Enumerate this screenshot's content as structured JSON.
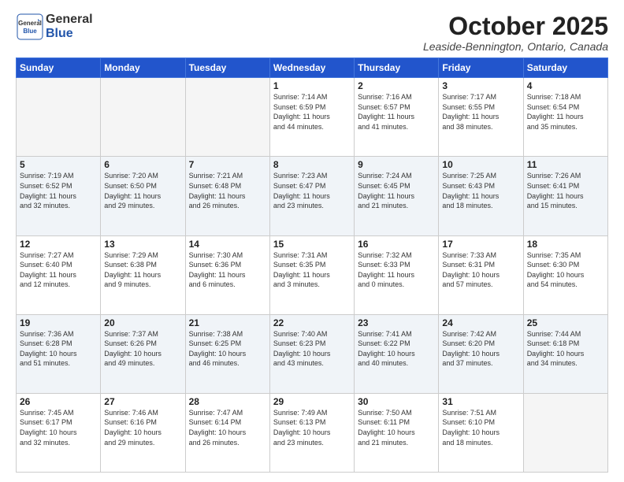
{
  "header": {
    "logo_line1": "General",
    "logo_line2": "Blue",
    "month": "October 2025",
    "location": "Leaside-Bennington, Ontario, Canada"
  },
  "weekdays": [
    "Sunday",
    "Monday",
    "Tuesday",
    "Wednesday",
    "Thursday",
    "Friday",
    "Saturday"
  ],
  "weeks": [
    [
      {
        "day": "",
        "info": ""
      },
      {
        "day": "",
        "info": ""
      },
      {
        "day": "",
        "info": ""
      },
      {
        "day": "1",
        "info": "Sunrise: 7:14 AM\nSunset: 6:59 PM\nDaylight: 11 hours\nand 44 minutes."
      },
      {
        "day": "2",
        "info": "Sunrise: 7:16 AM\nSunset: 6:57 PM\nDaylight: 11 hours\nand 41 minutes."
      },
      {
        "day": "3",
        "info": "Sunrise: 7:17 AM\nSunset: 6:55 PM\nDaylight: 11 hours\nand 38 minutes."
      },
      {
        "day": "4",
        "info": "Sunrise: 7:18 AM\nSunset: 6:54 PM\nDaylight: 11 hours\nand 35 minutes."
      }
    ],
    [
      {
        "day": "5",
        "info": "Sunrise: 7:19 AM\nSunset: 6:52 PM\nDaylight: 11 hours\nand 32 minutes."
      },
      {
        "day": "6",
        "info": "Sunrise: 7:20 AM\nSunset: 6:50 PM\nDaylight: 11 hours\nand 29 minutes."
      },
      {
        "day": "7",
        "info": "Sunrise: 7:21 AM\nSunset: 6:48 PM\nDaylight: 11 hours\nand 26 minutes."
      },
      {
        "day": "8",
        "info": "Sunrise: 7:23 AM\nSunset: 6:47 PM\nDaylight: 11 hours\nand 23 minutes."
      },
      {
        "day": "9",
        "info": "Sunrise: 7:24 AM\nSunset: 6:45 PM\nDaylight: 11 hours\nand 21 minutes."
      },
      {
        "day": "10",
        "info": "Sunrise: 7:25 AM\nSunset: 6:43 PM\nDaylight: 11 hours\nand 18 minutes."
      },
      {
        "day": "11",
        "info": "Sunrise: 7:26 AM\nSunset: 6:41 PM\nDaylight: 11 hours\nand 15 minutes."
      }
    ],
    [
      {
        "day": "12",
        "info": "Sunrise: 7:27 AM\nSunset: 6:40 PM\nDaylight: 11 hours\nand 12 minutes."
      },
      {
        "day": "13",
        "info": "Sunrise: 7:29 AM\nSunset: 6:38 PM\nDaylight: 11 hours\nand 9 minutes."
      },
      {
        "day": "14",
        "info": "Sunrise: 7:30 AM\nSunset: 6:36 PM\nDaylight: 11 hours\nand 6 minutes."
      },
      {
        "day": "15",
        "info": "Sunrise: 7:31 AM\nSunset: 6:35 PM\nDaylight: 11 hours\nand 3 minutes."
      },
      {
        "day": "16",
        "info": "Sunrise: 7:32 AM\nSunset: 6:33 PM\nDaylight: 11 hours\nand 0 minutes."
      },
      {
        "day": "17",
        "info": "Sunrise: 7:33 AM\nSunset: 6:31 PM\nDaylight: 10 hours\nand 57 minutes."
      },
      {
        "day": "18",
        "info": "Sunrise: 7:35 AM\nSunset: 6:30 PM\nDaylight: 10 hours\nand 54 minutes."
      }
    ],
    [
      {
        "day": "19",
        "info": "Sunrise: 7:36 AM\nSunset: 6:28 PM\nDaylight: 10 hours\nand 51 minutes."
      },
      {
        "day": "20",
        "info": "Sunrise: 7:37 AM\nSunset: 6:26 PM\nDaylight: 10 hours\nand 49 minutes."
      },
      {
        "day": "21",
        "info": "Sunrise: 7:38 AM\nSunset: 6:25 PM\nDaylight: 10 hours\nand 46 minutes."
      },
      {
        "day": "22",
        "info": "Sunrise: 7:40 AM\nSunset: 6:23 PM\nDaylight: 10 hours\nand 43 minutes."
      },
      {
        "day": "23",
        "info": "Sunrise: 7:41 AM\nSunset: 6:22 PM\nDaylight: 10 hours\nand 40 minutes."
      },
      {
        "day": "24",
        "info": "Sunrise: 7:42 AM\nSunset: 6:20 PM\nDaylight: 10 hours\nand 37 minutes."
      },
      {
        "day": "25",
        "info": "Sunrise: 7:44 AM\nSunset: 6:18 PM\nDaylight: 10 hours\nand 34 minutes."
      }
    ],
    [
      {
        "day": "26",
        "info": "Sunrise: 7:45 AM\nSunset: 6:17 PM\nDaylight: 10 hours\nand 32 minutes."
      },
      {
        "day": "27",
        "info": "Sunrise: 7:46 AM\nSunset: 6:16 PM\nDaylight: 10 hours\nand 29 minutes."
      },
      {
        "day": "28",
        "info": "Sunrise: 7:47 AM\nSunset: 6:14 PM\nDaylight: 10 hours\nand 26 minutes."
      },
      {
        "day": "29",
        "info": "Sunrise: 7:49 AM\nSunset: 6:13 PM\nDaylight: 10 hours\nand 23 minutes."
      },
      {
        "day": "30",
        "info": "Sunrise: 7:50 AM\nSunset: 6:11 PM\nDaylight: 10 hours\nand 21 minutes."
      },
      {
        "day": "31",
        "info": "Sunrise: 7:51 AM\nSunset: 6:10 PM\nDaylight: 10 hours\nand 18 minutes."
      },
      {
        "day": "",
        "info": ""
      }
    ]
  ]
}
